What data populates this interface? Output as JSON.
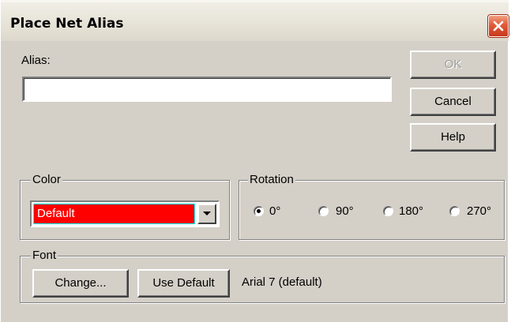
{
  "window": {
    "title": "Place Net Alias"
  },
  "alias": {
    "label": "Alias:",
    "value": "",
    "placeholder": ""
  },
  "buttons": {
    "ok_label": "OK",
    "ok_enabled": false,
    "cancel_label": "Cancel",
    "help_label": "Help"
  },
  "color_group": {
    "label": "Color",
    "selected_value": "Default",
    "swatch_color": "#ff0000",
    "text_color": "#ffffff"
  },
  "rotation_group": {
    "label": "Rotation",
    "options": [
      {
        "label": "0°",
        "selected": true
      },
      {
        "label": "90°",
        "selected": false
      },
      {
        "label": "180°",
        "selected": false
      },
      {
        "label": "270°",
        "selected": false
      }
    ]
  },
  "font_group": {
    "label": "Font",
    "change_label": "Change...",
    "use_default_label": "Use Default",
    "current_font": "Arial 7 (default)"
  },
  "icons": {
    "close": "close-x-icon",
    "dropdown": "chevron-down-icon"
  },
  "colors": {
    "dialog_bg": "#d4d0c8",
    "close_button": "#e05a3a"
  }
}
